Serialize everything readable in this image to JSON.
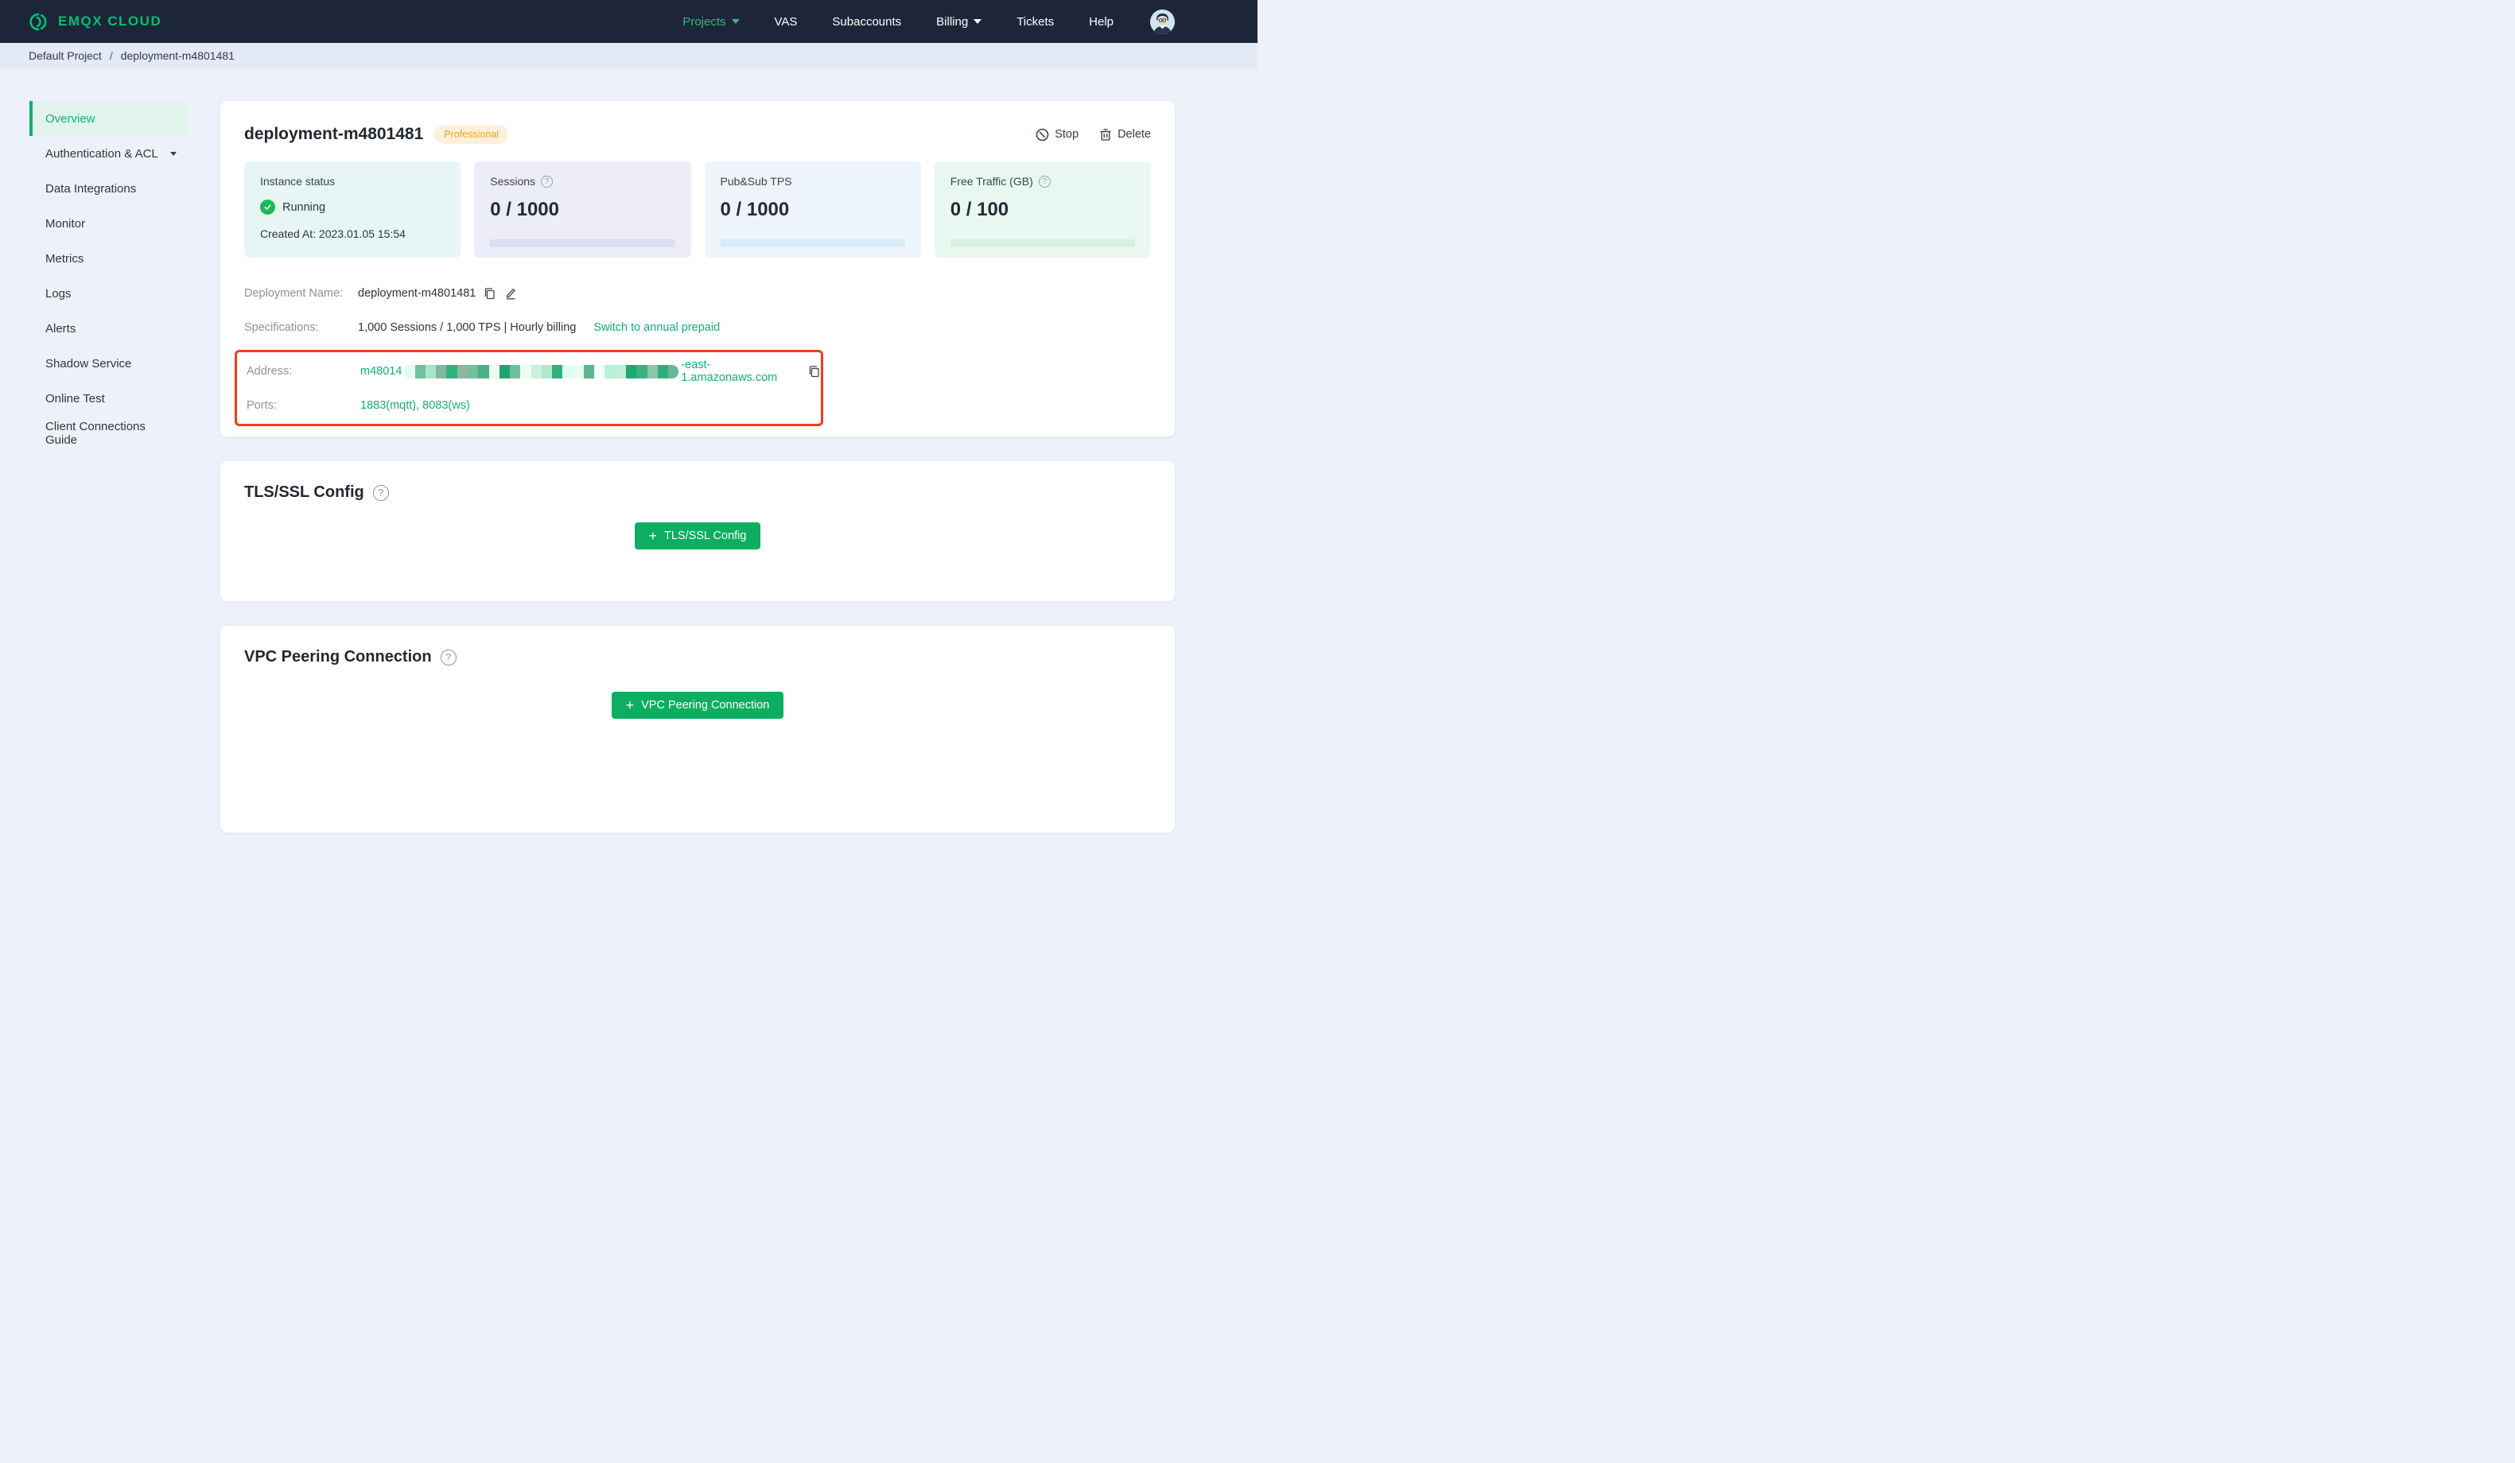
{
  "header": {
    "logo_text": "EMQX CLOUD",
    "nav": [
      {
        "label": "Projects"
      },
      {
        "label": "VAS"
      },
      {
        "label": "Subaccounts"
      },
      {
        "label": "Billing"
      },
      {
        "label": "Tickets"
      },
      {
        "label": "Help"
      }
    ]
  },
  "breadcrumb": {
    "project": "Default Project",
    "separator": "/",
    "deployment": "deployment-m4801481"
  },
  "sidebar": {
    "items": [
      {
        "label": "Overview"
      },
      {
        "label": "Authentication & ACL"
      },
      {
        "label": "Data Integrations"
      },
      {
        "label": "Monitor"
      },
      {
        "label": "Metrics"
      },
      {
        "label": "Logs"
      },
      {
        "label": "Alerts"
      },
      {
        "label": "Shadow Service"
      },
      {
        "label": "Online Test"
      },
      {
        "label": "Client Connections Guide"
      }
    ]
  },
  "overview": {
    "title": "deployment-m4801481",
    "plan_badge": "Professional",
    "actions": {
      "stop": "Stop",
      "delete": "Delete"
    },
    "stats": [
      {
        "label": "Instance status",
        "status": "Running",
        "created_at": "Created At: 2023.01.05 15:54"
      },
      {
        "label": "Sessions",
        "value": "0 / 1000"
      },
      {
        "label": "Pub&Sub TPS",
        "value": "0 / 1000"
      },
      {
        "label": "Free Traffic (GB)",
        "value": "0 / 100"
      }
    ],
    "details": {
      "deployment_name_label": "Deployment Name:",
      "deployment_name": "deployment-m4801481",
      "specifications_label": "Specifications:",
      "specifications": "1,000 Sessions / 1,000 TPS | Hourly billing",
      "specifications_link": "Switch to annual prepaid",
      "address_label": "Address:",
      "address_prefix": "m48014",
      "address_suffix": "-east-1.amazonaws.com",
      "address_mosaic_colors": [
        "#e3fbf1",
        "#6fc29c",
        "#a8e4c8",
        "#85b6a2",
        "#2db47d",
        "#8db5a5",
        "#74c09c",
        "#4cae85",
        "#eafcf5",
        "#1fa572",
        "#6fbf9b",
        "#f0fdf7",
        "#c9f2df",
        "#aee9cf",
        "#33b07c",
        "#dffbf0",
        "#e8fcf4",
        "#5fb38f",
        "#f1fef9",
        "#baf0da",
        "#c3ecd9",
        "#1ca973",
        "#39b27f",
        "#88c7a8",
        "#2fae7b",
        "#63ba93"
      ],
      "ports_label": "Ports:",
      "ports": "1883(mqtt), 8083(ws)"
    }
  },
  "tls_section": {
    "title": "TLS/SSL Config",
    "button": "TLS/SSL Config"
  },
  "vpc_section": {
    "title": "VPC Peering Connection",
    "button": "VPC Peering Connection"
  },
  "colors": {
    "brand_green": "#00c173",
    "link_green": "#10b176",
    "button_green": "#0cae61",
    "header_bg": "#1d2639",
    "annotation_red": "#f43b1e",
    "badge_orange": "#f7a326"
  }
}
